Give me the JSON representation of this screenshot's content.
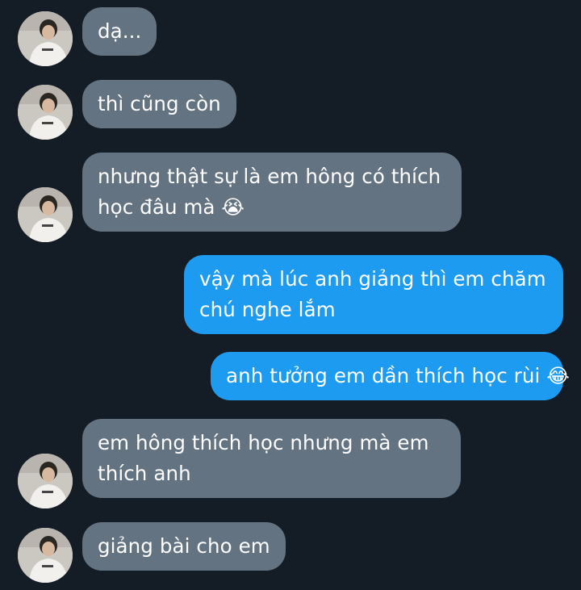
{
  "conversation": {
    "messages": [
      {
        "direction": "in",
        "lines": [
          "dạ..."
        ]
      },
      {
        "direction": "in",
        "lines": [
          "thì cũng còn"
        ]
      },
      {
        "direction": "in",
        "lines": [
          "nhưng thật sự là em hông có thích",
          "học đâu mà 😭"
        ]
      },
      {
        "direction": "out",
        "lines": [
          "vậy mà lúc anh giảng thì em chăm",
          "chú nghe lắm"
        ]
      },
      {
        "direction": "out",
        "lines": [
          "anh tưởng em dần thích học rùi 😂"
        ]
      },
      {
        "direction": "in",
        "lines": [
          "em hông thích học nhưng mà em",
          "thích anh"
        ]
      },
      {
        "direction": "in",
        "lines": [
          "giảng bài cho em"
        ]
      }
    ]
  },
  "colors": {
    "background": "#141d26",
    "incoming_bubble": "#647382",
    "outgoing_bubble": "#1d9bf0",
    "text": "#ffffff"
  },
  "icons": {
    "avatar": "user-photo-avatar"
  }
}
